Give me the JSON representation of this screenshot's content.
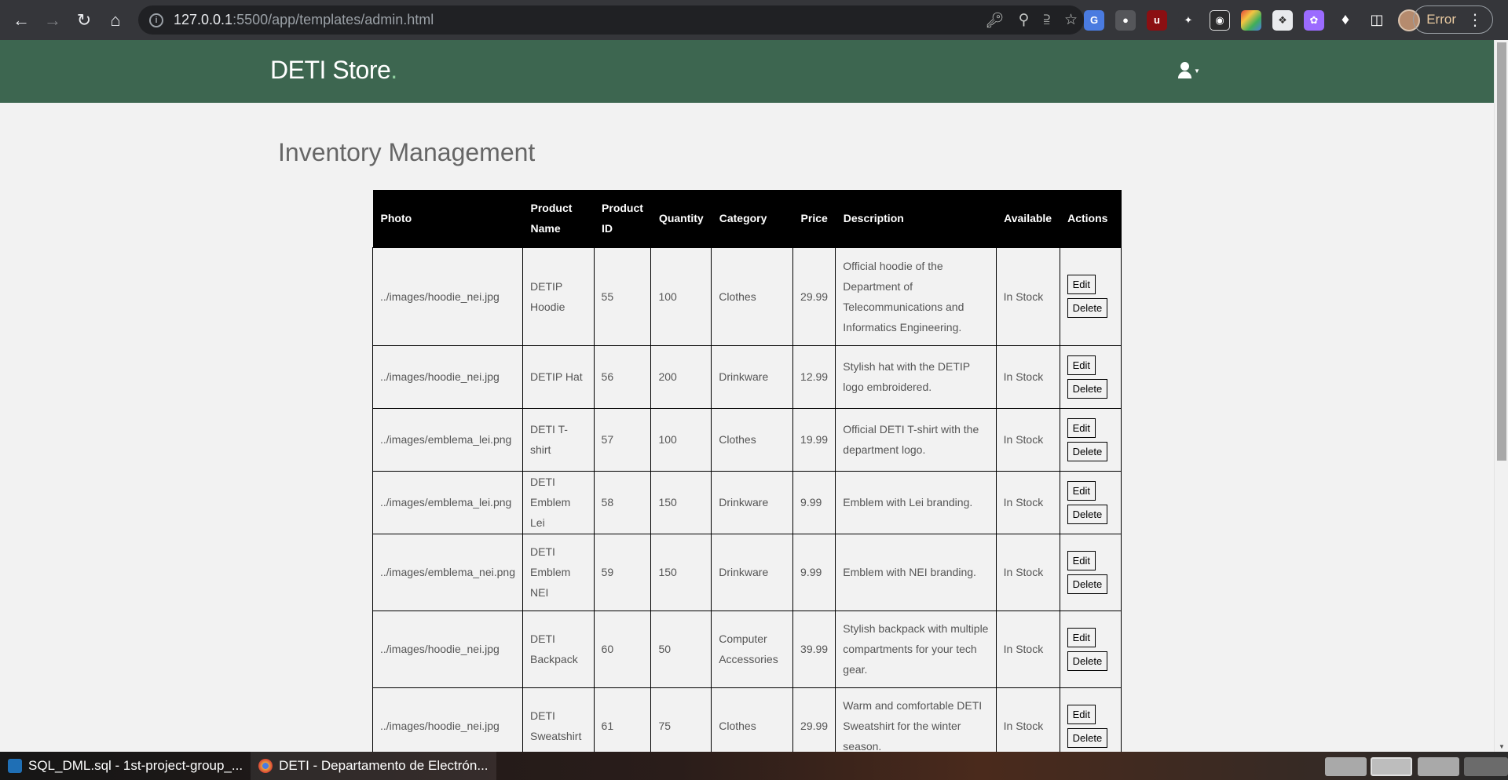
{
  "browser": {
    "url_host": "127.0.0.1",
    "url_rest": ":5500/app/templates/admin.html",
    "error_label": "Error"
  },
  "site": {
    "brand": "DETI Store",
    "brand_dot": "."
  },
  "page": {
    "title": "Inventory Management"
  },
  "table": {
    "headers": [
      "Photo",
      "Product Name",
      "Product ID",
      "Quantity",
      "Category",
      "Price",
      "Description",
      "Available",
      "Actions"
    ],
    "edit_label": "Edit",
    "delete_label": "Delete",
    "rows": [
      {
        "photo": "../images/hoodie_nei.jpg",
        "name": "DETIP Hoodie",
        "id": "55",
        "quantity": "100",
        "category": "Clothes",
        "price": "29.99",
        "description": "Official hoodie of the Department of Telecommunications and Informatics Engineering.",
        "available": "In Stock"
      },
      {
        "photo": "../images/hoodie_nei.jpg",
        "name": "DETIP Hat",
        "id": "56",
        "quantity": "200",
        "category": "Drinkware",
        "price": "12.99",
        "description": "Stylish hat with the DETIP logo embroidered.",
        "available": "In Stock"
      },
      {
        "photo": "../images/emblema_lei.png",
        "name": "DETI T-shirt",
        "id": "57",
        "quantity": "100",
        "category": "Clothes",
        "price": "19.99",
        "description": "Official DETI T-shirt with the department logo.",
        "available": "In Stock"
      },
      {
        "photo": "../images/emblema_lei.png",
        "name": "DETI Emblem Lei",
        "id": "58",
        "quantity": "150",
        "category": "Drinkware",
        "price": "9.99",
        "description": "Emblem with Lei branding.",
        "available": "In Stock"
      },
      {
        "photo": "../images/emblema_nei.png",
        "name": "DETI Emblem NEI",
        "id": "59",
        "quantity": "150",
        "category": "Drinkware",
        "price": "9.99",
        "description": "Emblem with NEI branding.",
        "available": "In Stock"
      },
      {
        "photo": "../images/hoodie_nei.jpg",
        "name": "DETI Backpack",
        "id": "60",
        "quantity": "50",
        "category": "Computer Accessories",
        "price": "39.99",
        "description": "Stylish backpack with multiple compartments for your tech gear.",
        "available": "In Stock"
      },
      {
        "photo": "../images/hoodie_nei.jpg",
        "name": "DETI Sweatshirt",
        "id": "61",
        "quantity": "75",
        "category": "Clothes",
        "price": "29.99",
        "description": "Warm and comfortable DETI Sweatshirt for the winter season.",
        "available": "In Stock"
      }
    ]
  },
  "taskbar": {
    "items": [
      {
        "label": "SQL_DML.sql - 1st-project-group_...",
        "icon": "vscode-icon",
        "color": "#1f6fb5"
      },
      {
        "label": "DETI - Departamento de Electrón...",
        "icon": "chrome-icon",
        "color": "#e8a33d"
      }
    ]
  },
  "colors": {
    "header_bg": "#3d6650",
    "table_header_bg": "#000000",
    "page_bg": "#f2f2f2"
  }
}
